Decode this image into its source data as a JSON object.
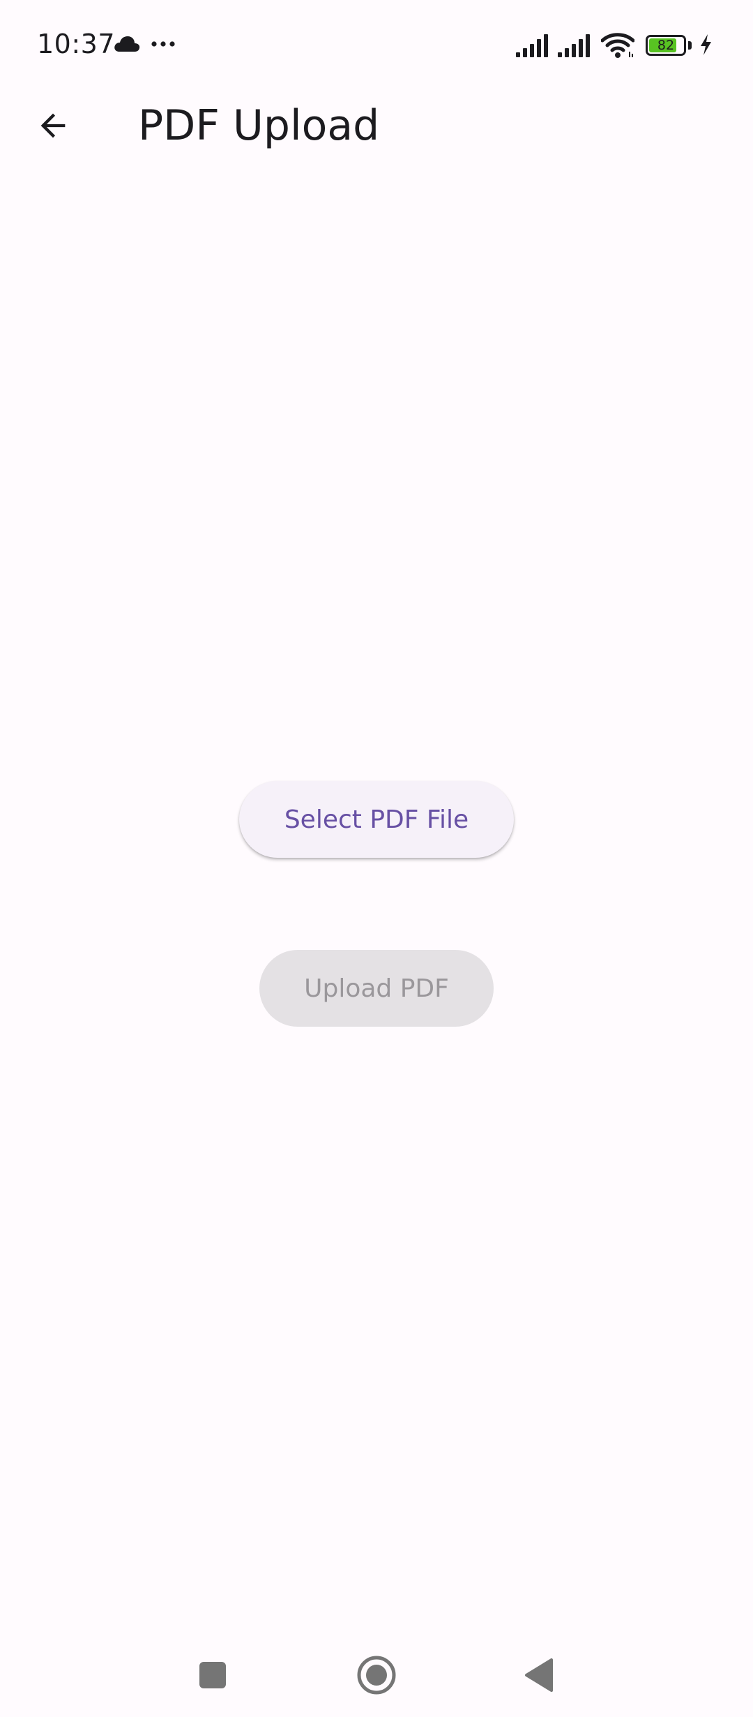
{
  "status_bar": {
    "time": "10:37",
    "battery_level": "82",
    "battery_fraction": 0.82,
    "icons": [
      "cloud-icon",
      "more-dots-icon",
      "signal-icon",
      "signal-icon",
      "wifi-icon",
      "battery-icon",
      "charging-bolt-icon"
    ]
  },
  "app_bar": {
    "title": "PDF Upload",
    "back_icon": "arrow-back-icon"
  },
  "main": {
    "select_button_label": "Select PDF File",
    "upload_button_label": "Upload PDF",
    "upload_button_enabled": false
  },
  "nav_bar": {
    "icons": [
      "recents-square-icon",
      "home-circle-icon",
      "back-triangle-icon"
    ]
  },
  "colors": {
    "background": "#FFFBFE",
    "primary": "#6750A4",
    "select_button_bg": "#F6F1F9",
    "disabled_button_bg": "#E4E1E4",
    "disabled_text": "#9A979B",
    "battery_fill": "#58C322",
    "on_surface": "#1C1B1F",
    "nav_icon": "#757575"
  }
}
